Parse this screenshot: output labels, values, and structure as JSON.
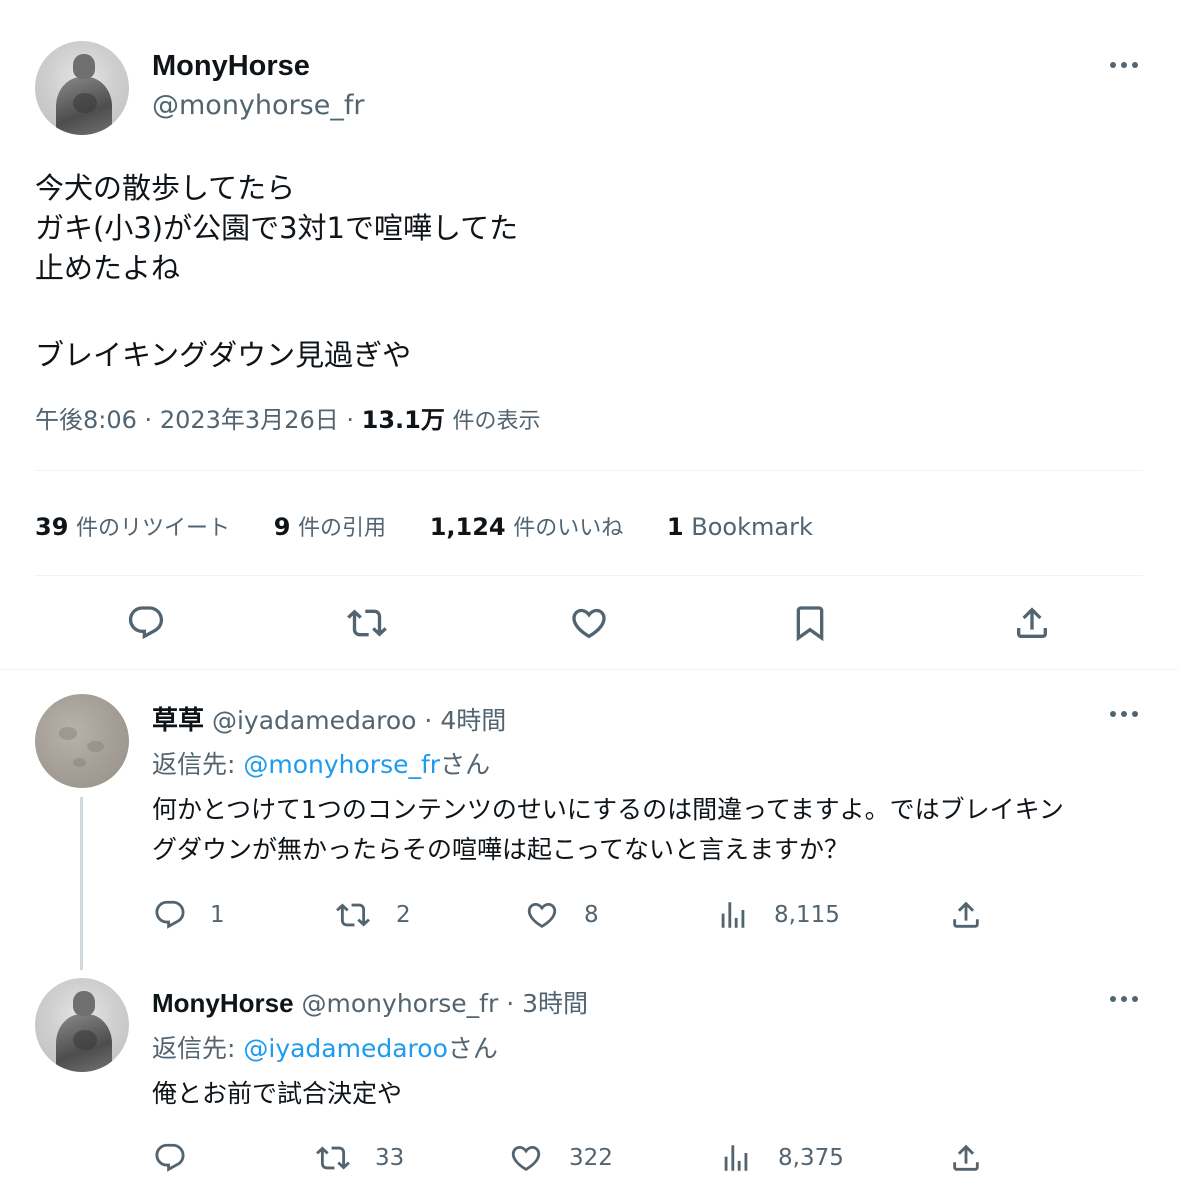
{
  "main_tweet": {
    "display_name": "MonyHorse",
    "handle": "@monyhorse_fr",
    "text_lines": [
      "今犬の散歩してたら",
      "ガキ(小3)が公園で3対1で喧嘩してた",
      "止めたよね",
      "",
      "ブレイキングダウン見過ぎや"
    ],
    "time": "午後8:06",
    "date": "2023年3月26日",
    "views_num": "13.1万",
    "views_label": "件の表示",
    "separator": "·"
  },
  "stats": {
    "retweets_num": "39",
    "retweets_label": "件のリツイート",
    "quotes_num": "9",
    "quotes_label": "件の引用",
    "likes_num": "1,124",
    "likes_label": "件のいいね",
    "bookmarks_num": "1",
    "bookmarks_label": "Bookmark"
  },
  "action_bar_icons": [
    "reply-icon",
    "retweet-icon",
    "like-icon",
    "bookmark-icon",
    "share-icon"
  ],
  "replies": [
    {
      "display_name": "草草",
      "handle": "@iyadamedaroo",
      "separator": "·",
      "time": "4時間",
      "reply_prefix": "返信先: ",
      "reply_to": "@monyhorse_fr",
      "reply_suffix": "さん",
      "text_lines": [
        "何かとつけて1つのコンテンツのせいにするのは間違ってますよ。ではブレイキン",
        "グダウンが無かったらその喧嘩は起こってないと言えますか？"
      ],
      "reply_count": "1",
      "retweet_count": "2",
      "like_count": "8",
      "view_count": "8,115"
    },
    {
      "display_name": "MonyHorse",
      "handle": "@monyhorse_fr",
      "separator": "·",
      "time": "3時間",
      "reply_prefix": "返信先: ",
      "reply_to": "@iyadamedaroo",
      "reply_suffix": "さん",
      "text_lines": [
        "俺とお前で試合決定や"
      ],
      "reply_count": "",
      "retweet_count": "33",
      "like_count": "322",
      "view_count": "8,375"
    }
  ],
  "colors": {
    "text": "#0f1419",
    "secondary": "#536471",
    "link": "#1d9bf0",
    "divider": "#eff3f4"
  }
}
